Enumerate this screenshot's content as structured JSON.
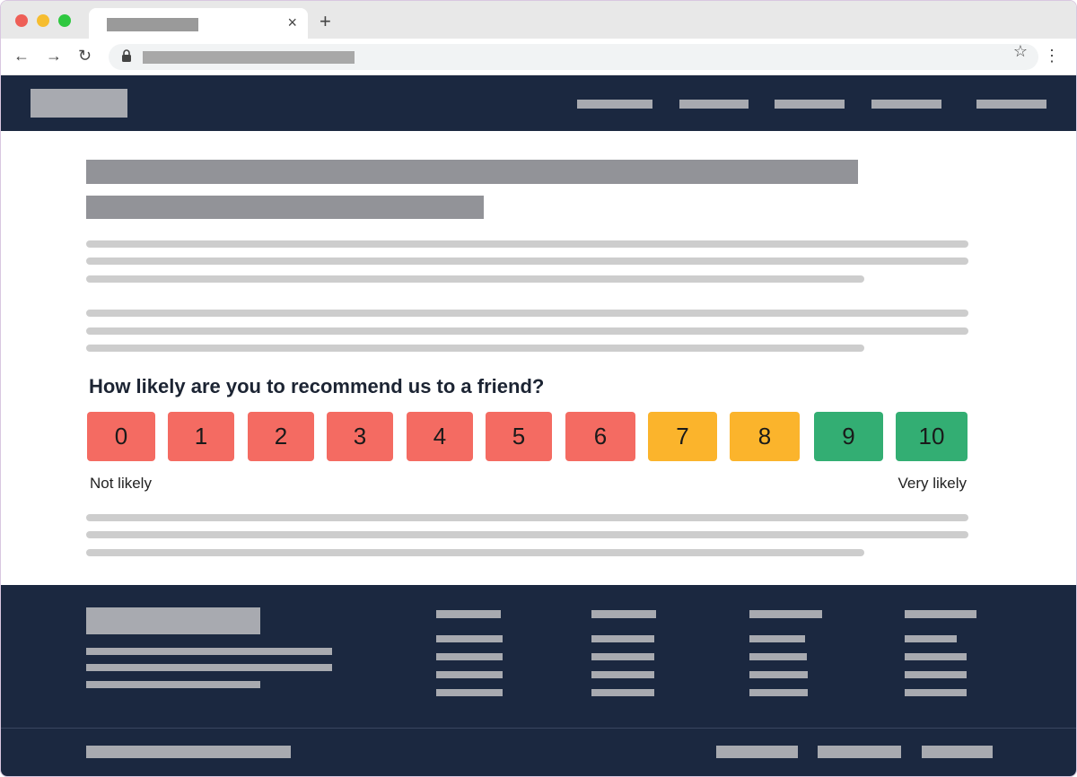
{
  "browser": {
    "tab_close": "×",
    "new_tab": "+",
    "back": "←",
    "forward": "→",
    "reload": "↻",
    "star": "☆",
    "menu": "⋮"
  },
  "survey": {
    "question": "How likely are you to recommend us to a friend?",
    "scores": [
      {
        "label": "0",
        "color": "#f46b62"
      },
      {
        "label": "1",
        "color": "#f46b62"
      },
      {
        "label": "2",
        "color": "#f46b62"
      },
      {
        "label": "3",
        "color": "#f46b62"
      },
      {
        "label": "4",
        "color": "#f46b62"
      },
      {
        "label": "5",
        "color": "#f46b62"
      },
      {
        "label": "6",
        "color": "#f46b62"
      },
      {
        "label": "7",
        "color": "#fbb42c"
      },
      {
        "label": "8",
        "color": "#fbb42c"
      },
      {
        "label": "9",
        "color": "#33ae73"
      },
      {
        "label": "10",
        "color": "#33ae73"
      }
    ],
    "low_label": "Not likely",
    "high_label": "Very likely"
  },
  "colors": {
    "header_bg": "#1b2840",
    "detractor": "#f46b62",
    "passive": "#fbb42c",
    "promoter": "#33ae73"
  }
}
